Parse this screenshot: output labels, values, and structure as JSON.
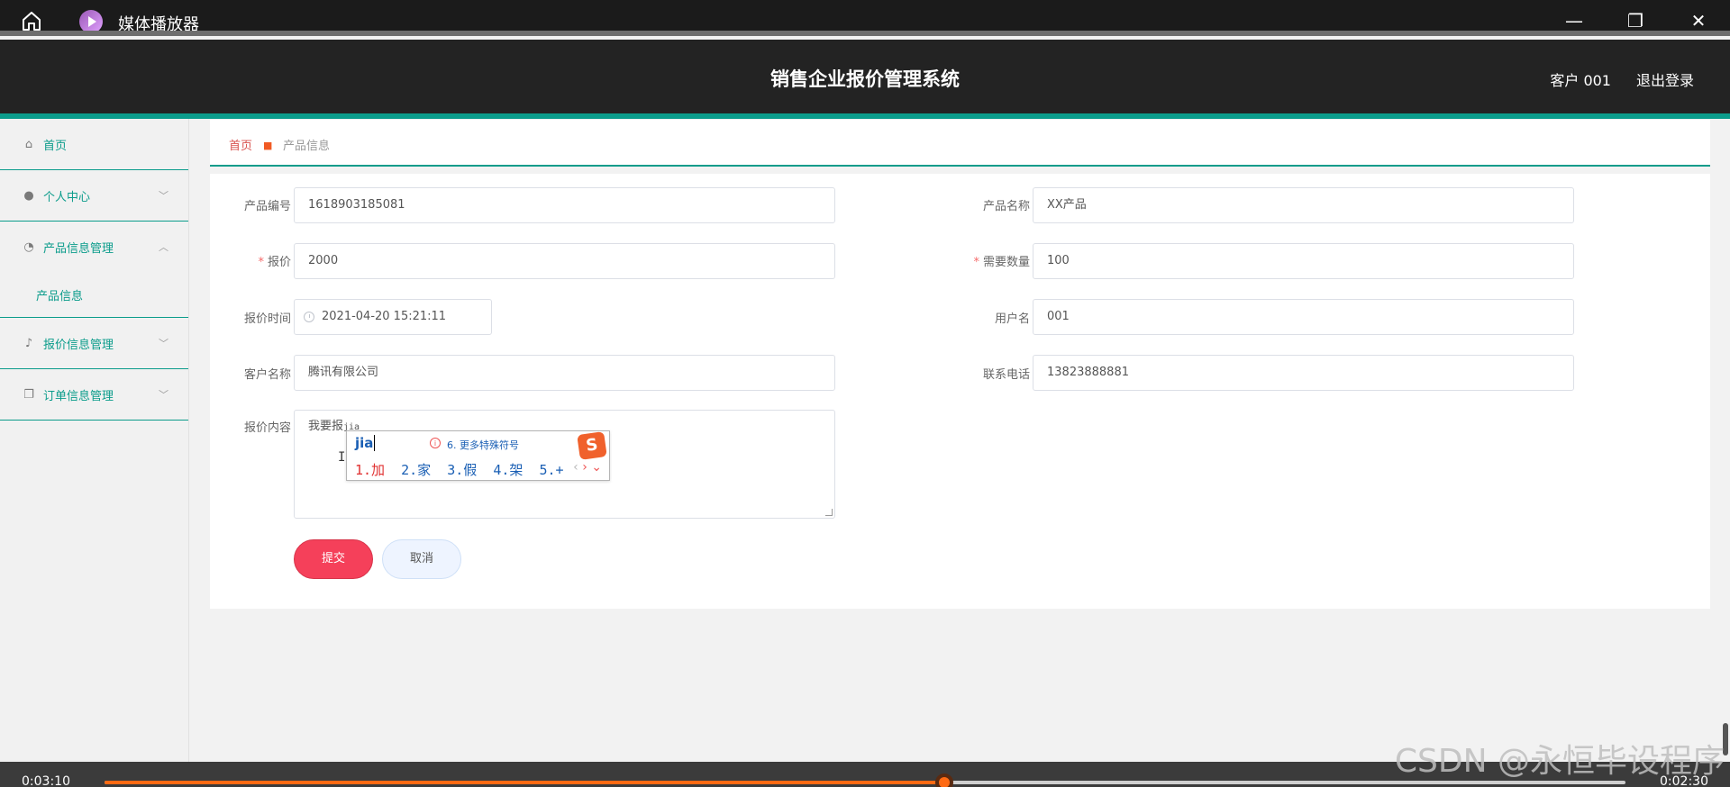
{
  "player": {
    "title": "媒体播放器",
    "time_elapsed": "0:03:10",
    "time_total": "0:02:30",
    "progress_percent": 55.2
  },
  "header": {
    "system_title": "销售企业报价管理系统",
    "user_label": "客户 001",
    "logout_label": "退出登录"
  },
  "sidebar": {
    "items": [
      {
        "label": "首页",
        "icon": "home-icon"
      },
      {
        "label": "个人中心",
        "icon": "user-icon"
      },
      {
        "label": "产品信息管理",
        "icon": "dashboard-icon"
      },
      {
        "label": "产品信息"
      },
      {
        "label": "报价信息管理",
        "icon": "mic-icon"
      },
      {
        "label": "订单信息管理",
        "icon": "copy-icon"
      }
    ]
  },
  "breadcrumb": {
    "home": "首页",
    "current": "产品信息"
  },
  "form": {
    "product_no": {
      "label": "产品编号",
      "value": "1618903185081"
    },
    "product_name": {
      "label": "产品名称",
      "value": "XX产品"
    },
    "quote": {
      "label": "报价",
      "value": "2000"
    },
    "quantity": {
      "label": "需要数量",
      "value": "100"
    },
    "quote_time": {
      "label": "报价时间",
      "value": "2021-04-20 15:21:11"
    },
    "username": {
      "label": "用户名",
      "value": "001"
    },
    "customer_name": {
      "label": "客户名称",
      "value": "腾讯有限公司"
    },
    "phone": {
      "label": "联系电话",
      "value": "13823888881"
    },
    "content": {
      "label": "报价内容",
      "value": "我要报",
      "composition": "jia"
    },
    "submit_label": "提交",
    "cancel_label": "取消"
  },
  "ime": {
    "pinyin": "jia",
    "hint": "6. 更多特殊符号",
    "logo": "S",
    "candidates": [
      "1.加",
      "2.家",
      "3.假",
      "4.架",
      "5.+"
    ]
  },
  "watermark": "CSDN @永恒毕设程序"
}
